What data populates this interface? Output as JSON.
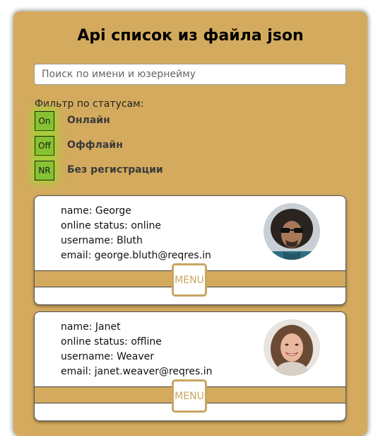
{
  "title": "Api список из файла json",
  "search": {
    "placeholder": "Поиск по имени и юзернейму",
    "value": ""
  },
  "filter": {
    "label": "Фильтр по статусам:",
    "options": [
      {
        "code": "On",
        "label": "Онлайн"
      },
      {
        "code": "Off",
        "label": "Оффлайн"
      },
      {
        "code": "NR",
        "label": "Без регистрации"
      }
    ]
  },
  "users": [
    {
      "name": "name: George",
      "status": "online status: online",
      "username": "username: Bluth",
      "email": "email: george.bluth@reqres.in",
      "menu": "MENU"
    },
    {
      "name": "name: Janet",
      "status": "online status: offline",
      "username": "username: Weaver",
      "email": "email: janet.weaver@reqres.in",
      "menu": "MENU"
    }
  ],
  "colors": {
    "panel": "#d4ab5e",
    "filter_button": "#86c232",
    "menu_border": "#c9a660"
  }
}
